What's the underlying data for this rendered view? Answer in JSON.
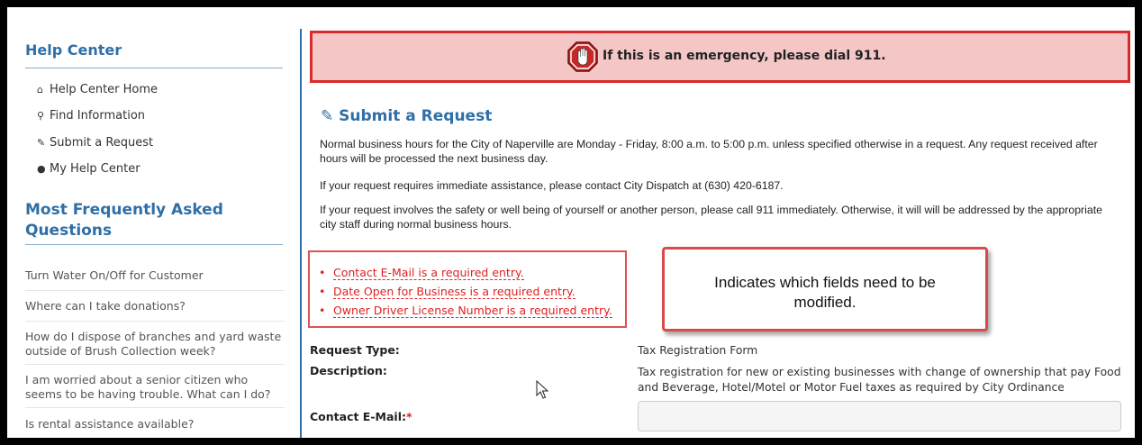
{
  "sidebar": {
    "help_title": "Help Center",
    "nav": [
      {
        "icon": "home-icon",
        "glyph": "⌂",
        "label": "Help Center Home"
      },
      {
        "icon": "search-icon",
        "glyph": "⚲",
        "label": "Find Information"
      },
      {
        "icon": "edit-icon",
        "glyph": "✎",
        "label": "Submit a Request"
      },
      {
        "icon": "user-icon",
        "glyph": "●",
        "label": "My Help Center"
      }
    ],
    "faq_title": "Most Frequently Asked Questions",
    "faqs": [
      "Turn Water On/Off for Customer",
      "Where can I take donations?",
      "How do I dispose of branches and yard waste outside of Brush Collection week?",
      "I am worried about a senior citizen who seems to be having trouble. What can I do?",
      "Is rental assistance available?"
    ]
  },
  "alert": {
    "message": "If this is an emergency, please dial 911.",
    "color": "#d92b2b",
    "background": "#f4c6c6"
  },
  "main": {
    "title": "Submit a Request",
    "para1": "Normal business hours for the City of Naperville are Monday - Friday, 8:00 a.m. to 5:00 p.m. unless specified otherwise in a request. Any request received after hours will be processed the next business day.",
    "para2": "If your request requires immediate assistance, please contact City Dispatch at (630) 420-6187.",
    "para3": "If your request involves the safety or well being of yourself or another person, please call 911 immediately. Otherwise, it will will be addressed by the appropriate city staff during normal business hours.",
    "errors": [
      "Contact E-Mail is a required entry.",
      "Date Open for Business is a required entry.",
      "Owner Driver License Number is a required entry."
    ],
    "callout": "Indicates which fields need to be modified.",
    "request_type_label": "Request Type:",
    "request_type_value": "Tax Registration Form",
    "description_label": "Description:",
    "description_value": "Tax registration for new or existing businesses with change of ownership that pay Food and Beverage, Hotel/Motel or Motor Fuel taxes as required by City Ordinance",
    "email_label": "Contact E-Mail:",
    "required_marker": "*",
    "email_value": "",
    "email_placeholder": ""
  },
  "colors": {
    "accent": "#2f6fa7",
    "error": "#e02020"
  }
}
